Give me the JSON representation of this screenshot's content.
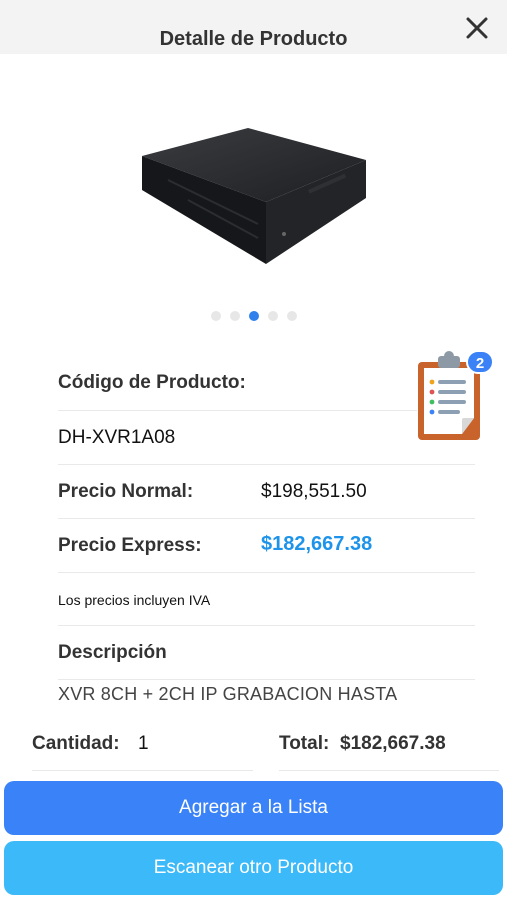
{
  "header": {
    "title": "Detalle de Producto"
  },
  "carousel": {
    "count": 5,
    "active_index": 2
  },
  "product": {
    "code_label": "Código de Producto:",
    "code": "DH-XVR1A08",
    "normal_price_label": "Precio Normal:",
    "normal_price": "$198,551.50",
    "express_price_label": "Precio Express:",
    "express_price": "$182,667.38",
    "tax_note": "Los precios incluyen IVA",
    "description_label": "Descripción",
    "description": "XVR 8CH + 2CH IP GRABACION HASTA"
  },
  "list_badge": {
    "count": "2"
  },
  "order": {
    "quantity_label": "Cantidad:",
    "quantity": "1",
    "total_label": "Total:",
    "total": "$182,667.38"
  },
  "buttons": {
    "add_to_list": "Agregar a la Lista",
    "scan_another": "Escanear otro Producto"
  },
  "colors": {
    "primary_button": "#3a82f7",
    "secondary_button": "#3cb9f9",
    "express_price": "#1e93ea",
    "badge": "#3b82f6"
  }
}
